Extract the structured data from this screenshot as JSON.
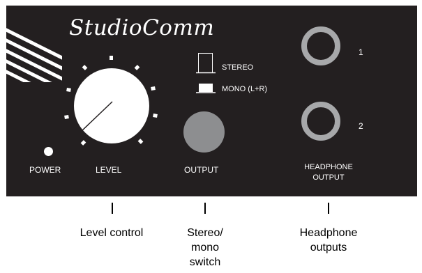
{
  "panel": {
    "brand": "StudioComm",
    "power_label": "POWER",
    "level_label": "LEVEL",
    "stereo_label": "STEREO",
    "mono_label": "MONO (L+R)",
    "output_label": "OUTPUT",
    "headphone_label_line1": "HEADPHONE",
    "headphone_label_line2": "OUTPUT",
    "jack1_number": "1",
    "jack2_number": "2"
  },
  "callouts": {
    "level": "Level control",
    "switch_line1": "Stereo/",
    "switch_line2": "mono",
    "switch_line3": "switch",
    "headphone_line1": "Headphone",
    "headphone_line2": "outputs"
  },
  "colors": {
    "panel": "#231f20",
    "knob": "#ffffff",
    "jack_ring": "#a7a8aa",
    "output_button": "#8d8e90"
  }
}
